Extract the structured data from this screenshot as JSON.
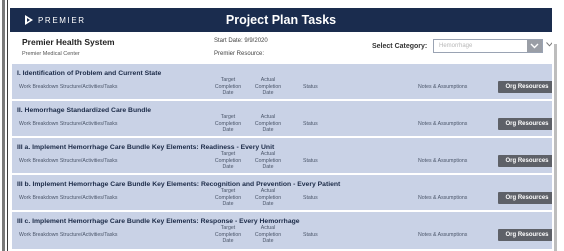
{
  "header": {
    "brand": "PREMIER",
    "title": "Project Plan Tasks"
  },
  "info": {
    "org_name": "Premier Health System",
    "org_sub": "Premier Medical Center",
    "start_date": "Start Date: 9/9/2020",
    "resource": "Premier Resource:",
    "category_label": "Select Category:",
    "category_value": "Hemorrhage"
  },
  "columns": {
    "wbs": "Work Breakdown Structure/Activities/Tasks",
    "target": [
      "Target",
      "Completion",
      "Date"
    ],
    "actual": [
      "Actual",
      "Completion",
      "Date"
    ],
    "status": "Status",
    "notes": "Notes & Assumptions",
    "button": "Org Resources"
  },
  "sections": [
    {
      "title": "I. Identification of Problem and Current State"
    },
    {
      "title": "II. Hemorrhage Standardized Care Bundle"
    },
    {
      "title": "III a. Implement Hemorrhage Care Bundle Key Elements: Readiness - Every Unit"
    },
    {
      "title": "III b. Implement Hemorrhage Care Bundle Key Elements: Recognition and Prevention - Every Patient"
    },
    {
      "title": "III c. Implement Hemorrhage Care Bundle Key Elements: Response - Every Hemorrhage"
    }
  ],
  "colors": {
    "header_bg": "#1a2c4e",
    "section_bg": "#c9d2e6",
    "button_bg": "#5e6168"
  },
  "icons": {
    "logo": "premier-logo-icon",
    "dropdown": "chevron-down-icon",
    "extra": "chevron-down-icon"
  }
}
